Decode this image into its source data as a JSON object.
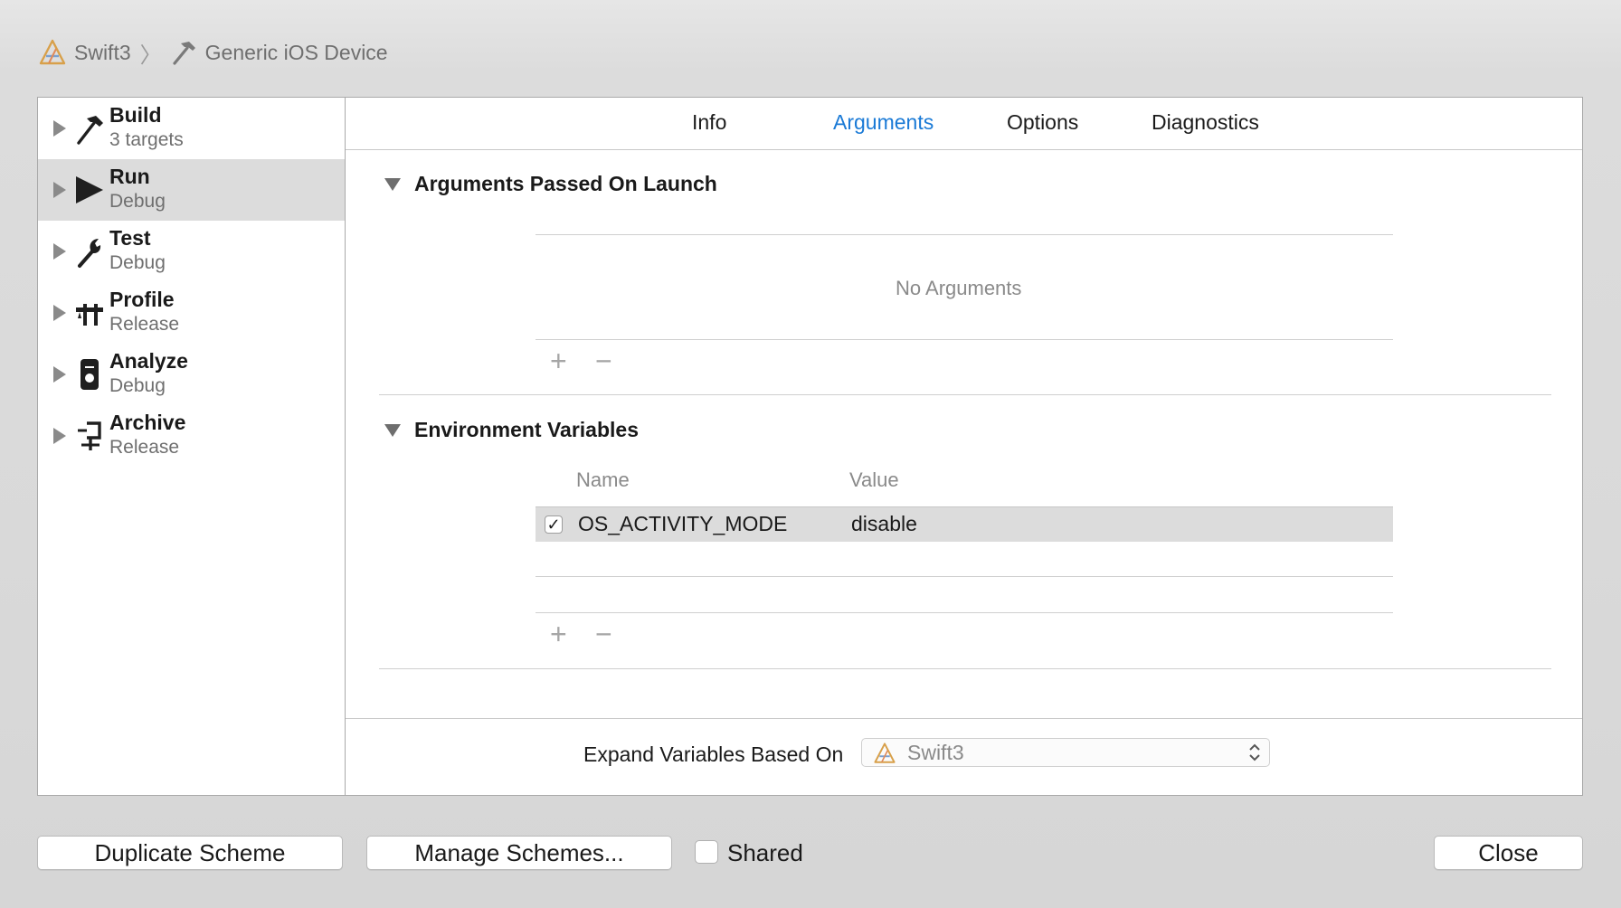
{
  "breadcrumb": {
    "project": "Swift3",
    "device": "Generic iOS Device"
  },
  "sidebar": {
    "items": [
      {
        "title": "Build",
        "subtitle": "3 targets",
        "icon": "hammer-icon"
      },
      {
        "title": "Run",
        "subtitle": "Debug",
        "icon": "play-icon",
        "selected": true
      },
      {
        "title": "Test",
        "subtitle": "Debug",
        "icon": "wrench-icon"
      },
      {
        "title": "Profile",
        "subtitle": "Release",
        "icon": "instruments-icon"
      },
      {
        "title": "Analyze",
        "subtitle": "Debug",
        "icon": "analyze-icon"
      },
      {
        "title": "Archive",
        "subtitle": "Release",
        "icon": "archive-icon"
      }
    ]
  },
  "tabs": [
    {
      "label": "Info"
    },
    {
      "label": "Arguments",
      "active": true
    },
    {
      "label": "Options"
    },
    {
      "label": "Diagnostics"
    }
  ],
  "arguments_section": {
    "title": "Arguments Passed On Launch",
    "empty_text": "No Arguments",
    "add": "+",
    "remove": "−"
  },
  "env_section": {
    "title": "Environment Variables",
    "columns": {
      "name": "Name",
      "value": "Value"
    },
    "rows": [
      {
        "checked": true,
        "check_mark": "✓",
        "name": "OS_ACTIVITY_MODE",
        "value": "disable"
      }
    ],
    "add": "+",
    "remove": "−"
  },
  "expand": {
    "label": "Expand Variables Based On",
    "selected": "Swift3"
  },
  "footer": {
    "duplicate": "Duplicate Scheme",
    "manage": "Manage Schemes...",
    "shared": "Shared",
    "shared_checked": false,
    "close": "Close"
  },
  "colors": {
    "accent": "#1a7ad6",
    "selected_row": "#dcdcdc"
  }
}
